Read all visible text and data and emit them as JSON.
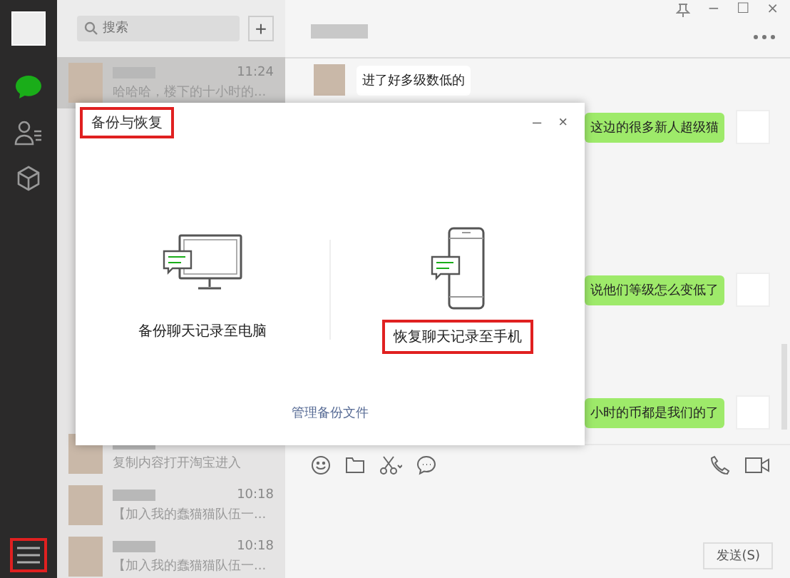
{
  "sidebar": {
    "menu_highlighted": true
  },
  "search": {
    "placeholder": "搜索",
    "add_button": "+"
  },
  "chats": [
    {
      "time": "11:24",
      "preview": "哈哈哈，楼下的十小时的...",
      "selected": true
    },
    {
      "preview": "复制内容打开淘宝进入",
      "selected": false
    },
    {
      "time": "10:18",
      "preview": "【加入我的蠢猫猫队伍一...",
      "selected": false
    },
    {
      "time": "10:18",
      "preview": "【加入我的蠢猫猫队伍一...",
      "selected": false
    }
  ],
  "window_controls": [
    "−",
    "☐",
    "×"
  ],
  "messages": [
    {
      "kind": "incoming",
      "text": "进了好多级数低的"
    },
    {
      "kind": "outgoing",
      "text": "这边的很多新人超级猫"
    },
    {
      "kind": "outgoing",
      "text": "说他们等级怎么变低了"
    },
    {
      "kind": "outgoing",
      "text": "小时的币都是我们的了"
    }
  ],
  "send_button": "发送(S)",
  "dialog": {
    "title": "备份与恢复",
    "title_highlighted": true,
    "minimize": "–",
    "close": "×",
    "options": [
      {
        "kind": "computer",
        "label": "备份聊天记录至电脑",
        "highlighted": false
      },
      {
        "kind": "phone",
        "label": "恢复聊天记录至手机",
        "highlighted": true
      }
    ],
    "link": "管理备份文件"
  }
}
